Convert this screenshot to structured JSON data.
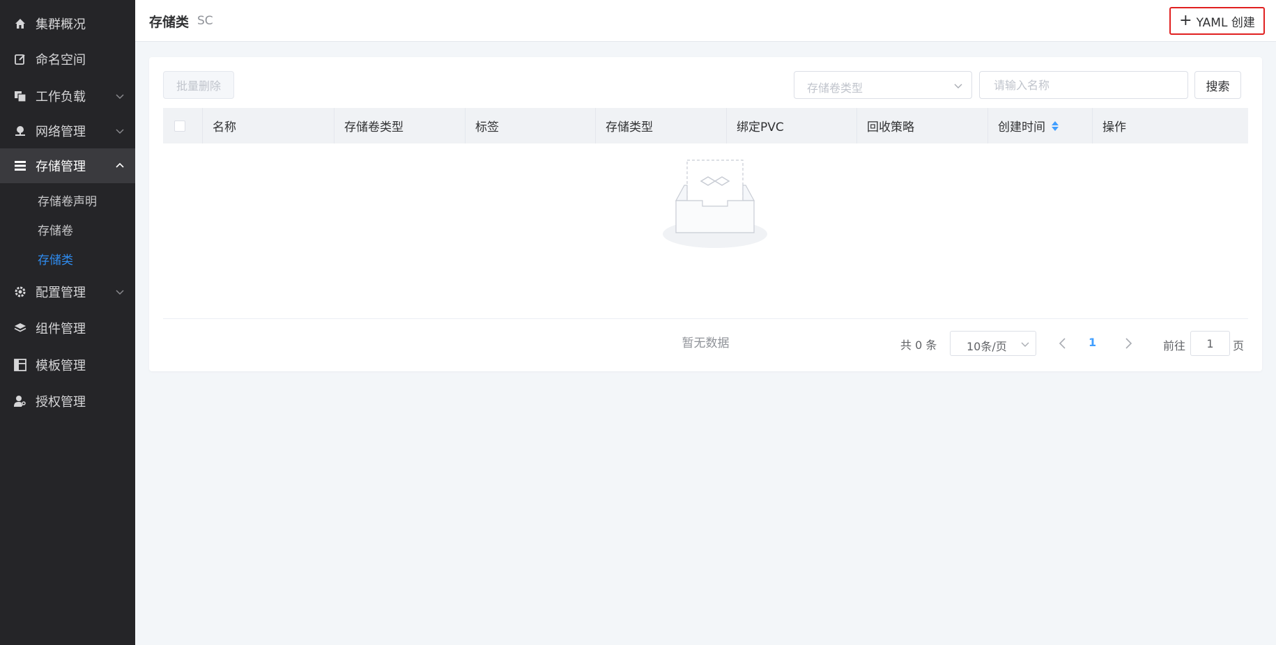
{
  "sidebar": {
    "items": [
      {
        "label": "集群概况",
        "icon": "home-icon"
      },
      {
        "label": "命名空间",
        "icon": "edit-icon"
      },
      {
        "label": "工作负载",
        "icon": "copy-icon",
        "expandable": true
      },
      {
        "label": "网络管理",
        "icon": "network-icon",
        "expandable": true
      },
      {
        "label": "存储管理",
        "icon": "storage-icon",
        "expandable": true,
        "expanded": true
      },
      {
        "label": "配置管理",
        "icon": "gear-icon",
        "expandable": true
      },
      {
        "label": "组件管理",
        "icon": "layers-icon"
      },
      {
        "label": "模板管理",
        "icon": "template-icon"
      },
      {
        "label": "授权管理",
        "icon": "user-key-icon"
      }
    ],
    "sub_items": [
      {
        "label": "存储卷声明"
      },
      {
        "label": "存储卷"
      },
      {
        "label": "存储类",
        "current": true
      }
    ]
  },
  "header": {
    "title": "存储类",
    "subtitle": "SC",
    "yaml_button": "YAML 创建"
  },
  "toolbar": {
    "batch_delete": "批量删除",
    "type_select_placeholder": "存储卷类型",
    "name_placeholder": "请输入名称",
    "search_button": "搜索"
  },
  "table": {
    "columns": [
      "名称",
      "存储卷类型",
      "标签",
      "存储类型",
      "绑定PVC",
      "回收策略",
      "创建时间",
      "操作"
    ],
    "rows": [],
    "empty_text": "暂无数据"
  },
  "pagination": {
    "total_text": "共 0 条",
    "page_size": "10条/页",
    "current_page": "1",
    "goto_label": "前往",
    "goto_value": "1",
    "goto_suffix": "页"
  },
  "colors": {
    "sidebar_bg": "#252528",
    "accent": "#2f8cf0",
    "highlight_border": "#e02020"
  }
}
